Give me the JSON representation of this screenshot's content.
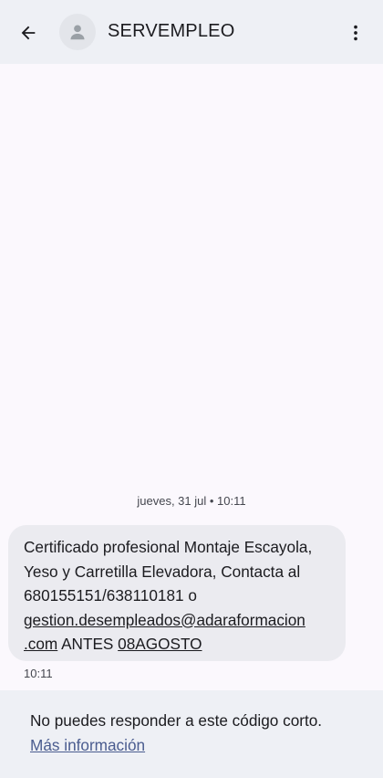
{
  "header": {
    "title": "SERVEMPLEO",
    "back_icon": "arrow-back-icon",
    "avatar_icon": "person-icon",
    "more_icon": "more-vert-icon"
  },
  "conversation": {
    "date_separator": "jueves, 31 jul • 10:11",
    "message": {
      "lines": [
        "Certificado profesional Montaje Escayola,",
        "Yeso y Carretilla Elevadora, Contacta al",
        "680155151/638110181 o"
      ],
      "email_part1": "gestion.desempleados@adaraformacion",
      "email_part2": ".com",
      "antes_text": " ANTES ",
      "date_link": "08AGOSTO",
      "time": "10:11"
    }
  },
  "footer": {
    "notice": "No puedes responder a este código corto.",
    "link_label": "Más información"
  },
  "colors": {
    "header_bg": "#eef0f5",
    "bubble_bg": "#ebebf0",
    "link": "#4a5c8f"
  }
}
